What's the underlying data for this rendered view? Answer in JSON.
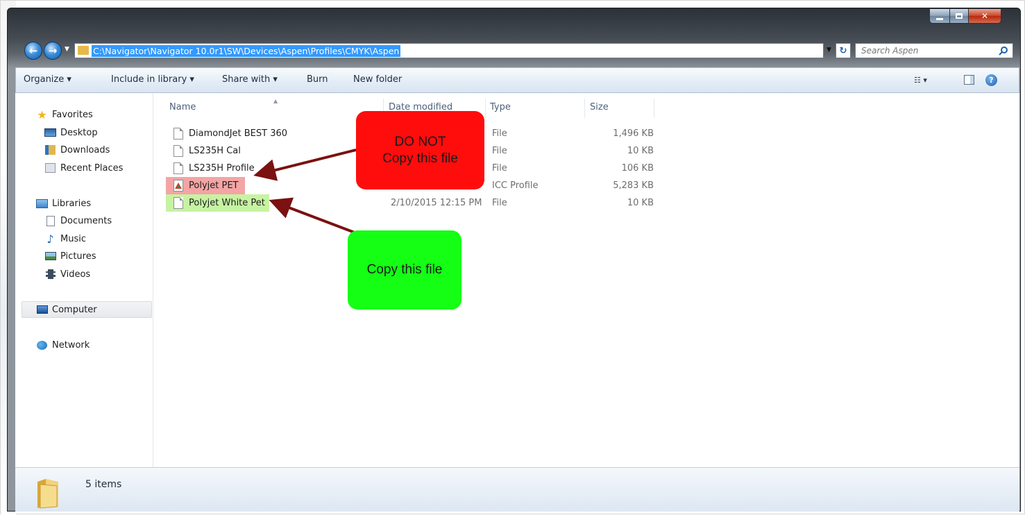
{
  "window": {
    "address_path": "C:\\Navigator\\Navigator 10.0r1\\SW\\Devices\\Aspen\\Profiles\\CMYK\\Aspen",
    "search_placeholder": "Search Aspen"
  },
  "toolbar": {
    "organize": "Organize ▾",
    "include_in_library": "Include in library ▾",
    "share_with": "Share with ▾",
    "burn": "Burn",
    "new_folder": "New folder"
  },
  "navpane": {
    "favorites": "Favorites",
    "desktop": "Desktop",
    "downloads": "Downloads",
    "recent_places": "Recent Places",
    "libraries": "Libraries",
    "documents": "Documents",
    "music": "Music",
    "pictures": "Pictures",
    "videos": "Videos",
    "computer": "Computer",
    "network": "Network"
  },
  "columns": {
    "name": "Name",
    "date_modified": "Date modified",
    "type": "Type",
    "size": "Size"
  },
  "files": [
    {
      "name": "DiamondJet BEST 360",
      "date": "",
      "type": "File",
      "size": "1,496 KB"
    },
    {
      "name": "LS235H Cal",
      "date": "",
      "type": "File",
      "size": "10 KB"
    },
    {
      "name": "LS235H Profile",
      "date": "",
      "type": "File",
      "size": "106 KB"
    },
    {
      "name": "Polyjet PET",
      "date": "",
      "type": "ICC Profile",
      "size": "5,283 KB"
    },
    {
      "name": "Polyjet White Pet",
      "date": "2/10/2015 12:15 PM",
      "type": "File",
      "size": "10 KB"
    }
  ],
  "status": {
    "items_count": "5 items"
  },
  "callouts": {
    "do_not_line1": "DO NOT",
    "do_not_line2": "Copy this file",
    "copy": "Copy this file"
  },
  "colors": {
    "callout_red": "#ff0d0d",
    "callout_green": "#15ff15",
    "arrow": "#7b1111",
    "highlight_red": "#f4a4a4",
    "highlight_green": "#c6f3a2",
    "address_selection": "#3399ff"
  }
}
